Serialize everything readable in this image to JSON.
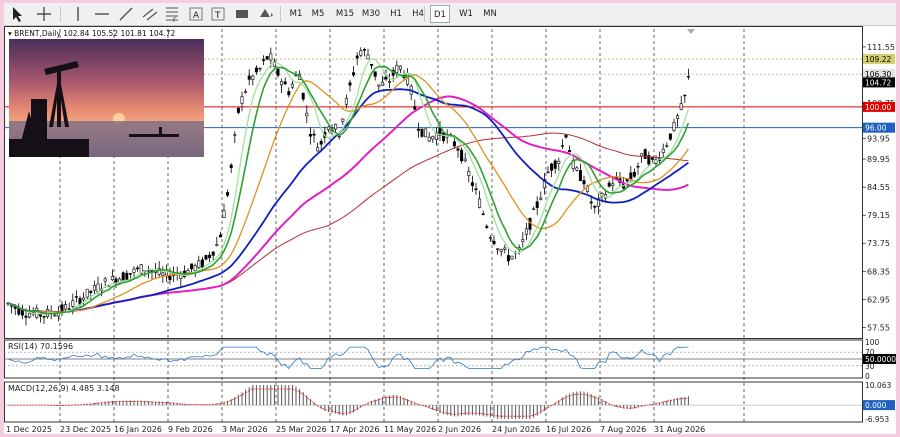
{
  "toolbar": {
    "tools": [
      "cursor-icon",
      "crosshair-icon",
      "vertical-line-icon",
      "horizontal-line-icon",
      "trendline-icon",
      "channel-icon",
      "fibonacci-icon",
      "text-icon",
      "label-icon",
      "rectangle-icon",
      "shapes-icon"
    ],
    "timeframes": [
      "M1",
      "M5",
      "M15",
      "M30",
      "H1",
      "H4",
      "D1",
      "W1",
      "MN"
    ],
    "active_timeframe": "D1"
  },
  "chart": {
    "header": "BRENT,Daily  102.84 105.52 101.81 104.72",
    "symbol": "BRENT,Daily",
    "ohlc": "102.84 105.52 101.81 104.72",
    "price_axis": [
      "111.55",
      "105.15",
      "100.75",
      "93.95",
      "89.95",
      "84.55",
      "79.15",
      "73.75",
      "68.35",
      "62.95",
      "57.55"
    ],
    "price_tags": [
      {
        "value": "109.22",
        "color": "#d4d070",
        "text_color": "#000000"
      },
      {
        "value": "106.30",
        "color": "#e0e0e0",
        "text_color": "#000000"
      },
      {
        "value": "104.72",
        "color": "#000000",
        "text_color": "#ffffff"
      },
      {
        "value": "100.00",
        "color": "#e00000",
        "text_color": "#ffffff"
      },
      {
        "value": "96.00",
        "color": "#2060c0",
        "text_color": "#ffffff"
      }
    ],
    "date_axis": [
      "1 Dec 2025",
      "23 Dec 2025",
      "16 Jan 2026",
      "9 Feb 2026",
      "3 Mar 2026",
      "25 Mar 2026",
      "17 Apr 2026",
      "11 May 2026",
      "2 Jun 2026",
      "24 Jun 2026",
      "16 Jul 2026",
      "7 Aug 2026",
      "31 Aug 2026"
    ],
    "rsi": {
      "title": "RSI(14) 70.1596",
      "axis": [
        "100",
        "70",
        "50.0000",
        "30",
        "0"
      ]
    },
    "macd": {
      "title": "MACD(12,26,9) 4.485 3.148",
      "axis": [
        "10.063",
        "0.000",
        "-6.953"
      ]
    },
    "colors": {
      "ma_fast": "#30a030",
      "ma_fast2": "#a0e0a0",
      "ma_mid": "#e09020",
      "ma_slow": "#1020c0",
      "ma_200": "#e020c0",
      "ma_long": "#b03030",
      "level_red": "#e00000",
      "level_blue": "#2060c0"
    }
  }
}
